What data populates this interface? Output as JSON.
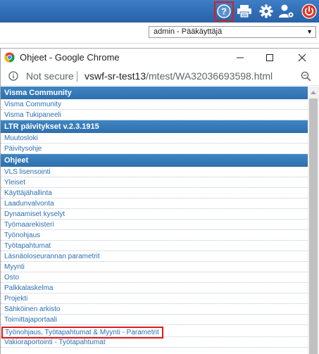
{
  "app_toolbar": {
    "icons": [
      "help-icon",
      "print-icon",
      "gear-icon",
      "user-settings-icon",
      "power-icon"
    ],
    "user_select_value": "admin - Pääkäyttäjä"
  },
  "window": {
    "title": "Ohjeet - Google Chrome",
    "controls": [
      "minimize-icon",
      "maximize-icon",
      "close-icon"
    ]
  },
  "address_bar": {
    "security_label": "Not secure",
    "url_host": "vswf-sr-test13",
    "url_path": "/mtest/WA32036693598.html"
  },
  "sections": [
    {
      "header": "Visma Community",
      "links": [
        "Visma Community",
        "Visma Tukipaneeli"
      ]
    },
    {
      "header": "LTR päivitykset v.2.3.1915",
      "links": [
        "Muutosloki",
        "Päivitysohje"
      ]
    },
    {
      "header": "Ohjeet",
      "links": [
        "VLS lisensointi",
        "Yleiset",
        "Käyttäjähallinta",
        "Laadunvalvonta",
        "Dynaamiset kyselyt",
        "Työmaarekisteri",
        "Työnohjaus",
        "Työtapahtumat",
        "Läsnäoloseurannan parametrit",
        "Myynti",
        "Osto",
        "Palkkalaskelma",
        "Projekti",
        "Sähköinen arkisto",
        "Toimittajaportaali",
        "Työnohjaus, Työtapahtumat & Myynti - Parametrit",
        "Vakioraportointi - Työtapahtumat"
      ]
    }
  ],
  "colors": {
    "toolbar_blue": "#2f6db5",
    "section_header": "#3279b8",
    "link": "#2c6fb0",
    "highlight_border": "#e01b1b"
  }
}
